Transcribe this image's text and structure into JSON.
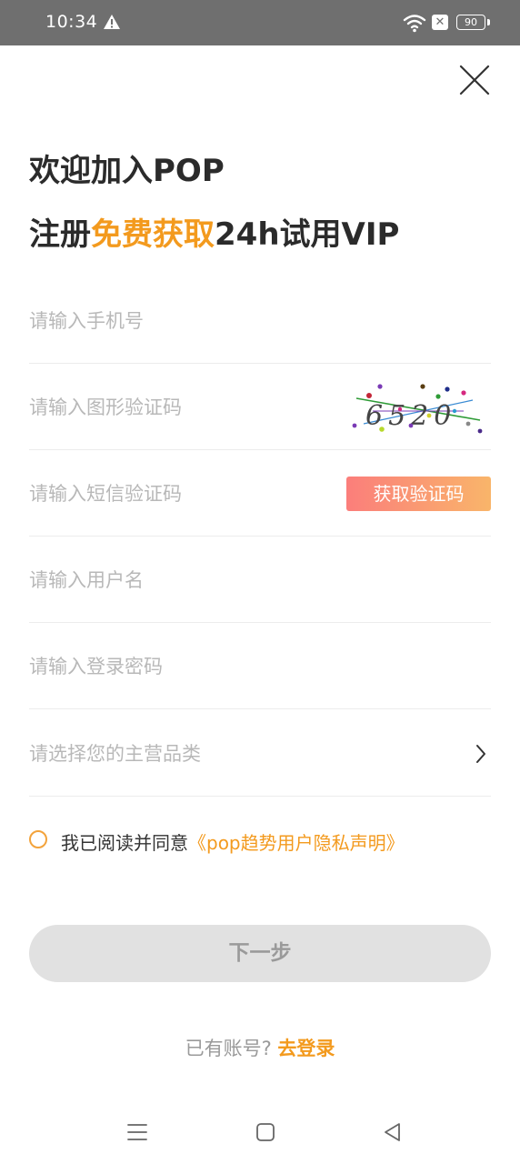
{
  "status_bar": {
    "time": "10:34",
    "battery": "90",
    "icons": [
      "warning-icon",
      "wifi-icon",
      "sim-blocked-icon",
      "battery-icon"
    ]
  },
  "header": {
    "close_icon": "close-icon",
    "title_line1": "欢迎加入POP",
    "title_line2_prefix": "注册",
    "title_line2_accent": "免费获取",
    "title_line2_suffix": "24h试用VIP"
  },
  "form": {
    "phone_placeholder": "请输入手机号",
    "phone_value": "",
    "captcha_placeholder": "请输入图形验证码",
    "captcha_value": "",
    "captcha_image_text": "6520",
    "sms_placeholder": "请输入短信验证码",
    "sms_value": "",
    "sms_button_label": "获取验证码",
    "username_placeholder": "请输入用户名",
    "username_value": "",
    "password_placeholder": "请输入登录密码",
    "password_value": "",
    "category_placeholder": "请选择您的主营品类",
    "category_icon": "chevron-right-icon"
  },
  "agreement": {
    "checked": false,
    "text": "我已阅读并同意",
    "link": "《pop趋势用户隐私声明》"
  },
  "next_button": "下一步",
  "login": {
    "prompt": "已有账号?",
    "link": "去登录"
  },
  "nav_bar": {
    "icons": [
      "menu-icon",
      "home-icon",
      "back-icon"
    ]
  },
  "colors": {
    "accent": "#f39a1e",
    "status_bar_bg": "#6f6f6f",
    "sms_button_from": "#fb7e7b",
    "sms_button_to": "#f9b56a",
    "disabled_button_bg": "#e1e1e1"
  }
}
